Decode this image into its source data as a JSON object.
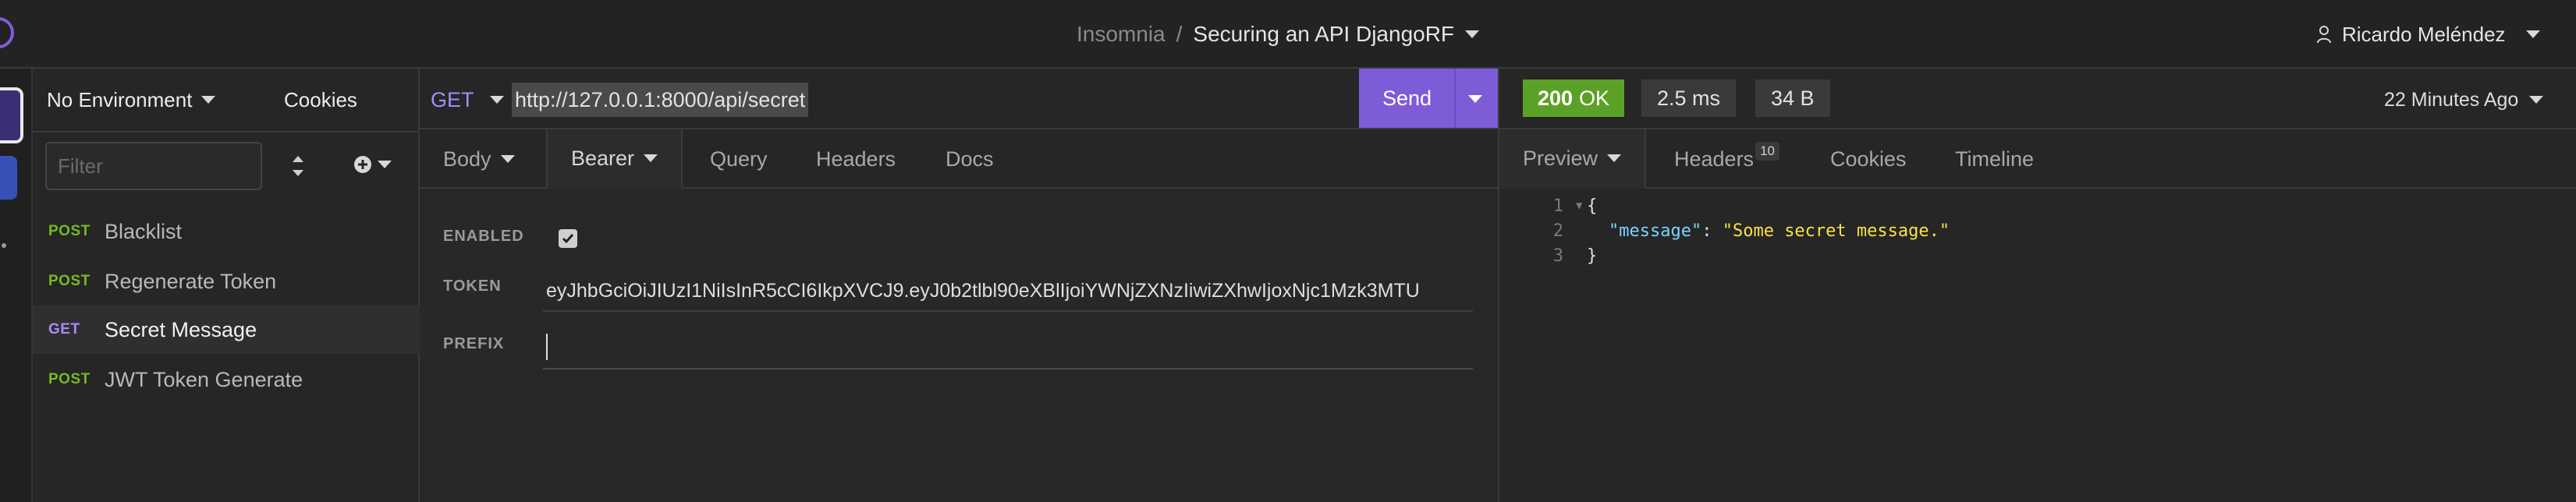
{
  "topbar": {
    "app_name": "Insomnia",
    "separator": "/",
    "workspace": "Securing an API DjangoRF",
    "user": "Ricardo Meléndez"
  },
  "sidebar": {
    "environment": "No Environment",
    "cookies": "Cookies",
    "filter_placeholder": "Filter",
    "items": [
      {
        "method": "POST",
        "label": "Blacklist"
      },
      {
        "method": "POST",
        "label": "Regenerate Token"
      },
      {
        "method": "GET",
        "label": "Secret Message"
      },
      {
        "method": "POST",
        "label": "JWT Token Generate"
      }
    ]
  },
  "request": {
    "method": "GET",
    "url": "http://127.0.0.1:8000/api/secret",
    "send_label": "Send",
    "tabs": [
      "Body",
      "Bearer",
      "Query",
      "Headers",
      "Docs"
    ],
    "auth": {
      "enabled_label": "ENABLED",
      "token_label": "TOKEN",
      "token_value": "eyJhbGciOiJIUzI1NiIsInR5cCI6IkpXVCJ9.eyJ0b2tlbl90eXBlIjoiYWNjZXNzIiwiZXhwIjoxNjc1Mzk3MTU",
      "prefix_label": "PREFIX"
    }
  },
  "response": {
    "status_code": "200",
    "status_text": "OK",
    "time": "2.5 ms",
    "size": "34 B",
    "time_ago": "22 Minutes Ago",
    "tabs": {
      "preview": "Preview",
      "headers": "Headers",
      "headers_count": "10",
      "cookies": "Cookies",
      "timeline": "Timeline"
    },
    "body": {
      "line_numbers": [
        "1",
        "2",
        "3"
      ],
      "open_brace": "{",
      "key": "\"message\"",
      "colon": ": ",
      "value": "\"Some secret message.\"",
      "close_brace": "}"
    }
  },
  "colors": {
    "accent": "#7e5cd8",
    "status_ok": "#5ca127",
    "post": "#75ba24",
    "get": "#a78bfa"
  }
}
